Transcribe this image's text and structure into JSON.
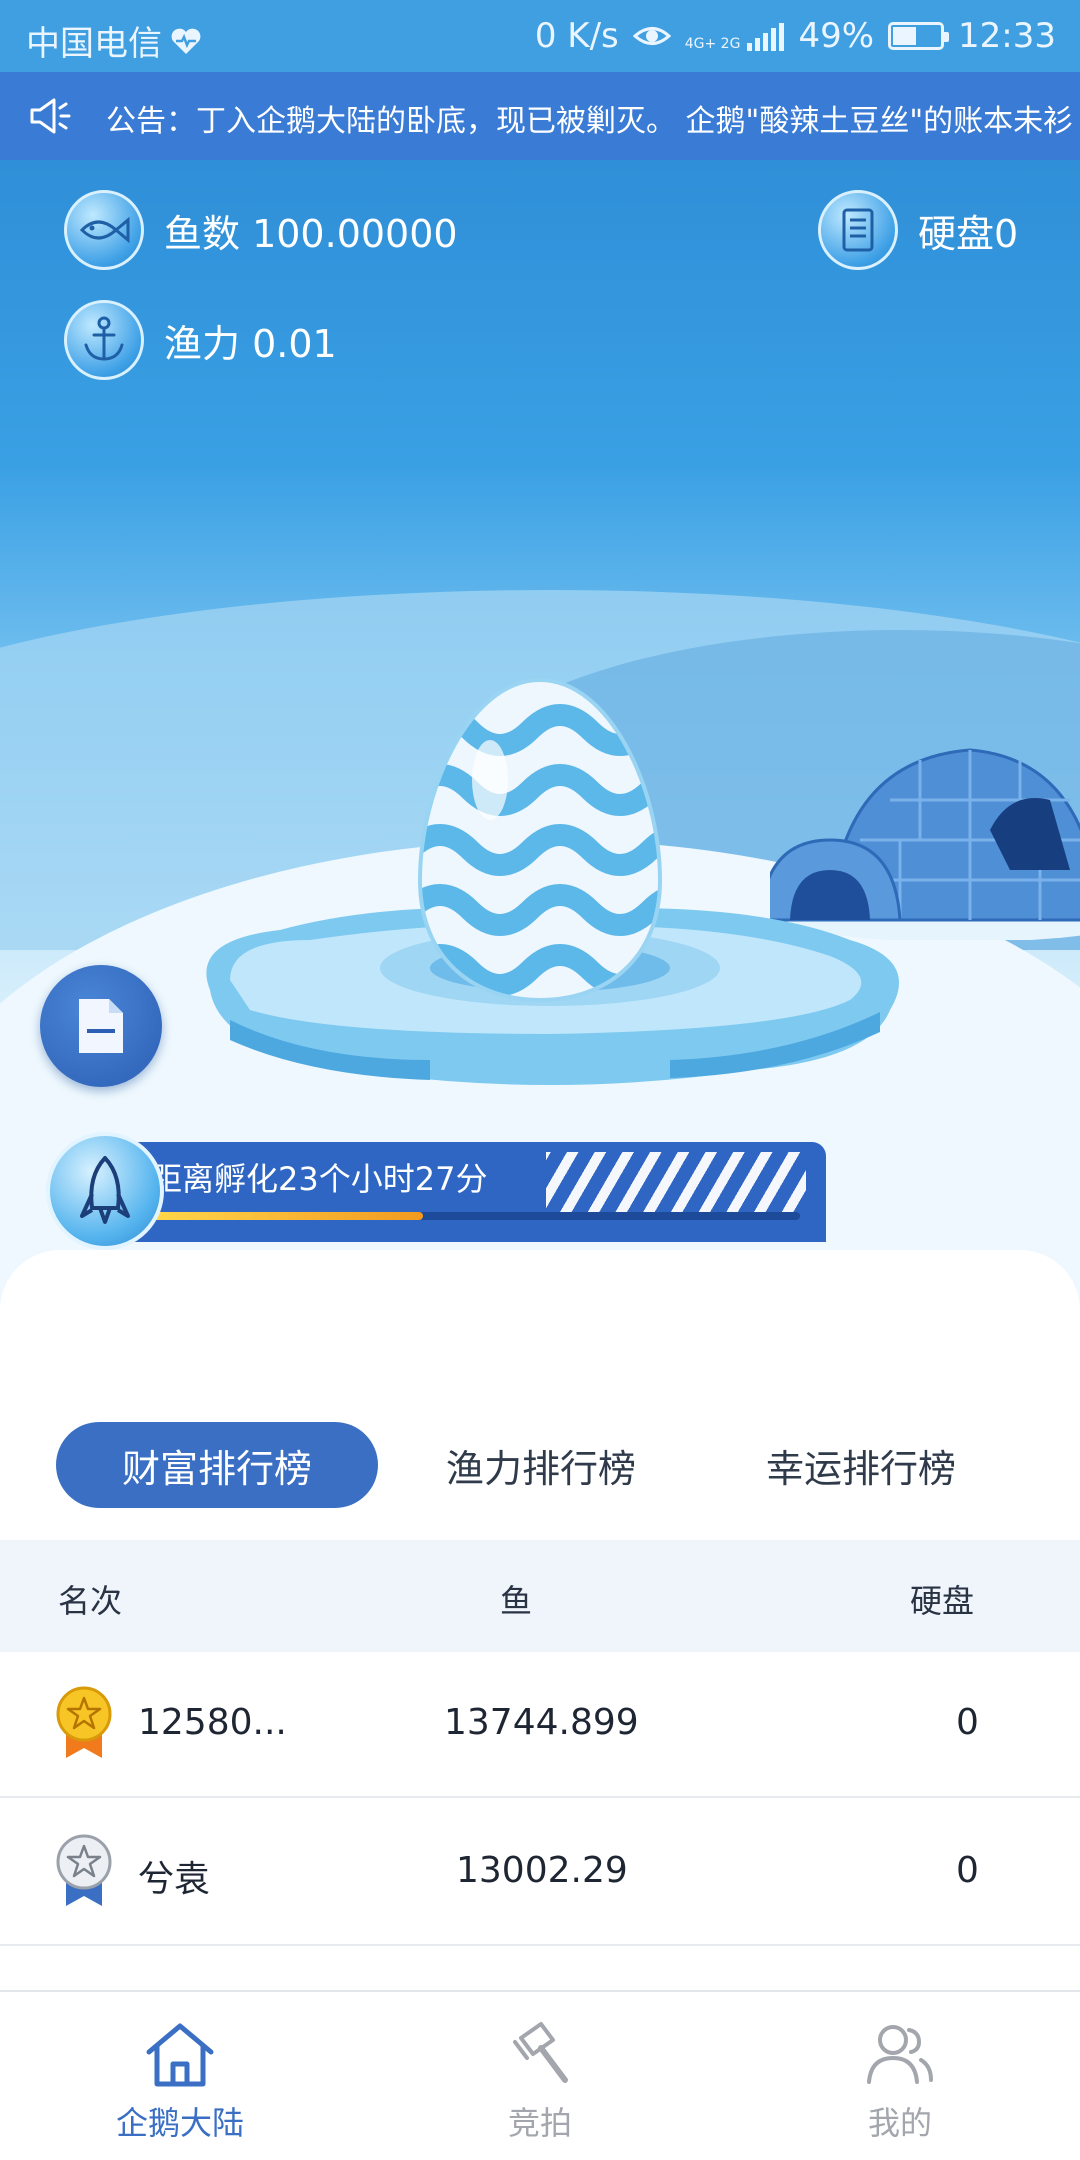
{
  "status_bar": {
    "carrier": "中国电信",
    "speed": "0 K/s",
    "network": "4G+ 2G",
    "battery": "49%",
    "battery_level": 0.49,
    "time": "12:33"
  },
  "notice": {
    "text": "公告：丁入企鹅大陆的卧底，现已被剿灭。 企鹅\"酸辣土豆丝\"的账本未衫"
  },
  "stats": {
    "fish": "鱼数 100.00000",
    "disk": "硬盘0",
    "power": "渔力 0.01"
  },
  "hatch": {
    "text": "距离孵化23个小时27分",
    "progress": 0.42
  },
  "tabs": {
    "wealth": "财富排行榜",
    "power": "渔力排行榜",
    "luck": "幸运排行榜"
  },
  "table": {
    "headers": {
      "rank": "名次",
      "fish": "鱼",
      "disk": "硬盘"
    },
    "rows": [
      {
        "name": "12580...",
        "fish": "13744.899",
        "disk": "0",
        "medal": "gold"
      },
      {
        "name": "兮袁",
        "fish": "13002.29",
        "disk": "0",
        "medal": "silver"
      }
    ]
  },
  "nav": {
    "home": "企鹅大陆",
    "auction": "竞拍",
    "mine": "我的"
  },
  "colors": {
    "primary": "#3a6fc4",
    "notice_bg": "#3a7bd5",
    "status_bg": "#3f9fe0"
  }
}
